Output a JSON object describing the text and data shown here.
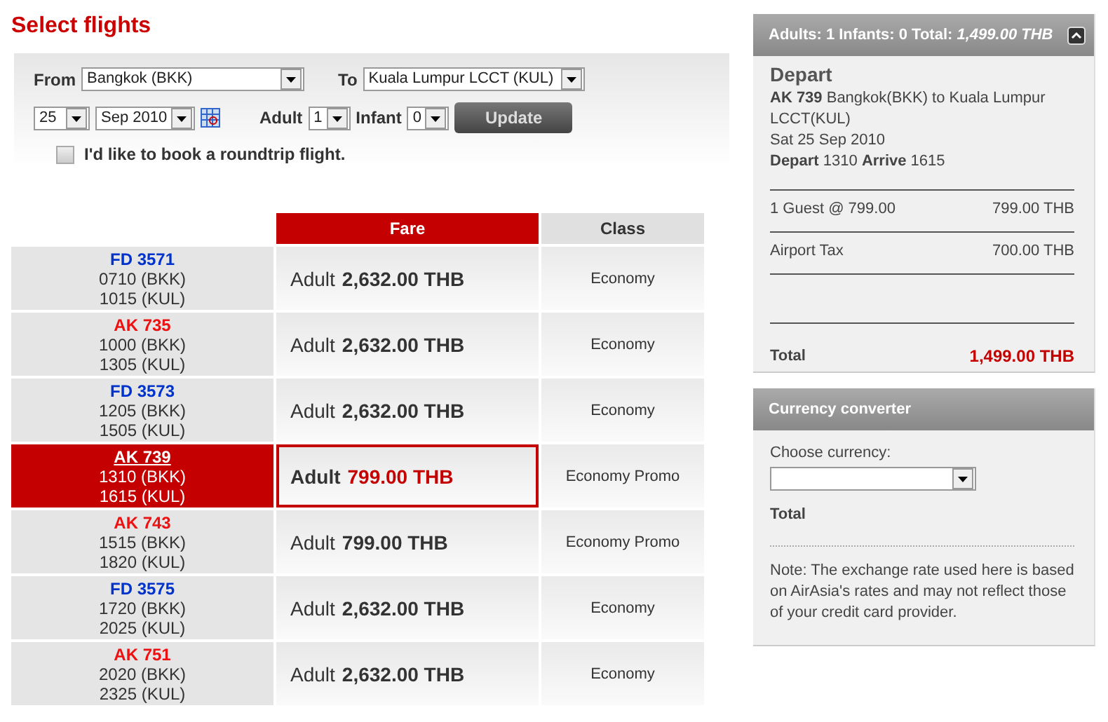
{
  "title": "Select flights",
  "search": {
    "from_label": "From",
    "from": "Bangkok (BKK)",
    "to_label": "To",
    "to": "Kuala Lumpur LCCT (KUL)",
    "day": "25",
    "month": "Sep 2010",
    "adult_label": "Adult",
    "adult": "1",
    "infant_label": "Infant",
    "infant": "0",
    "update_button": "Update",
    "roundtrip": {
      "label": "I'd like to book a roundtrip flight.",
      "checked": false
    }
  },
  "table": {
    "columns": [
      "Fare",
      "Class"
    ],
    "rows": [
      {
        "flight": "FD 3571",
        "color": "#0033cc",
        "depart": "0710 (BKK)",
        "arrive": "1015 (KUL)",
        "fare_label": "Adult",
        "fare": "2,632.00 THB",
        "class": "Economy",
        "selected": false
      },
      {
        "flight": "AK 735",
        "color": "#ee1111",
        "depart": "1000 (BKK)",
        "arrive": "1305 (KUL)",
        "fare_label": "Adult",
        "fare": "2,632.00 THB",
        "class": "Economy",
        "selected": false
      },
      {
        "flight": "FD 3573",
        "color": "#0033cc",
        "depart": "1205 (BKK)",
        "arrive": "1505 (KUL)",
        "fare_label": "Adult",
        "fare": "2,632.00 THB",
        "class": "Economy",
        "selected": false
      },
      {
        "flight": "AK 739",
        "depart": "1310 (BKK)",
        "arrive": "1615 (KUL)",
        "fare_label": "Adult",
        "fare": "799.00 THB",
        "class": "Economy Promo",
        "selected": true
      },
      {
        "flight": "AK 743",
        "color": "#ee1111",
        "depart": "1515 (BKK)",
        "arrive": "1820 (KUL)",
        "fare_label": "Adult",
        "fare": "799.00 THB",
        "class": "Economy Promo",
        "selected": false
      },
      {
        "flight": "FD 3575",
        "color": "#0033cc",
        "depart": "1720 (BKK)",
        "arrive": "2025 (KUL)",
        "fare_label": "Adult",
        "fare": "2,632.00 THB",
        "class": "Economy",
        "selected": false
      },
      {
        "flight": "AK 751",
        "color": "#ee1111",
        "depart": "2020 (BKK)",
        "arrive": "2325 (KUL)",
        "fare_label": "Adult",
        "fare": "2,632.00 THB",
        "class": "Economy",
        "selected": false
      }
    ]
  },
  "summary": {
    "header": "Adults: 1 Infants: 0 Total: *1,499.00 THB*",
    "heading": "Depart",
    "flight": "**AK 739** Bangkok(BKK) to Kuala Lumpur LCCT(KUL)",
    "date": "Sat 25 Sep 2010",
    "times": "**Depart** 1310 **Arrive** 1615",
    "lines": [
      {
        "label": "1 Guest @ 799.00",
        "amount": "799.00 THB"
      },
      {
        "label": "Airport Tax",
        "amount": "700.00 THB"
      }
    ],
    "total_label": "Total",
    "total": "1,499.00 THB"
  },
  "currency": {
    "header": "Currency converter",
    "choose_label": "Choose currency:",
    "total_label": "Total",
    "note": "Note: The exchange rate used here is based on AirAsia's rates and may not reflect those of your credit card provider."
  }
}
